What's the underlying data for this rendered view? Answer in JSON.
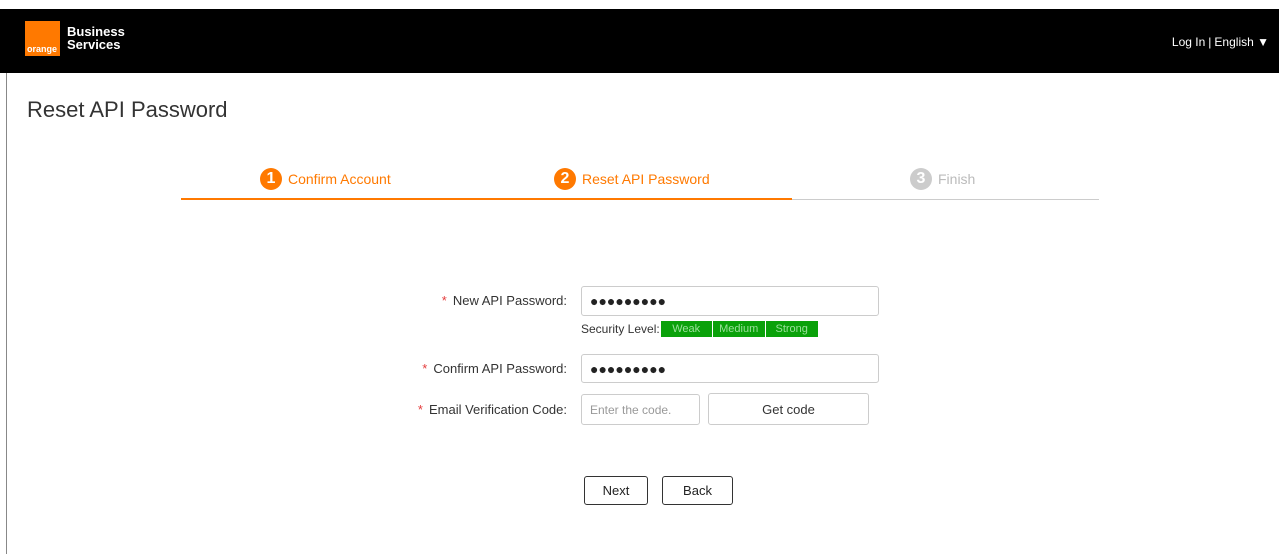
{
  "header": {
    "logo_text": "orange",
    "brand_line1": "Business",
    "brand_line2": "Services",
    "login": "Log In",
    "separator": "|",
    "language": "English ▼"
  },
  "page": {
    "title": "Reset API Password"
  },
  "stepper": {
    "steps": [
      {
        "num": "1",
        "label": "Confirm Account",
        "state": "active"
      },
      {
        "num": "2",
        "label": "Reset API Password",
        "state": "active"
      },
      {
        "num": "3",
        "label": "Finish",
        "state": "inactive"
      }
    ]
  },
  "form": {
    "required_mark": "*",
    "new_password": {
      "label": "New API Password:",
      "value": "●●●●●●●●●"
    },
    "security": {
      "label": "Security Level:",
      "levels": [
        "Weak",
        "Medium",
        "Strong"
      ]
    },
    "confirm_password": {
      "label": "Confirm API Password:",
      "value": "●●●●●●●●●"
    },
    "email_code": {
      "label": "Email Verification Code:",
      "placeholder": "Enter the code.",
      "get_code": "Get code"
    }
  },
  "actions": {
    "next": "Next",
    "back": "Back"
  },
  "colors": {
    "accent": "#ff7900",
    "security_green": "#0aa10a",
    "required": "#e43c3c"
  }
}
